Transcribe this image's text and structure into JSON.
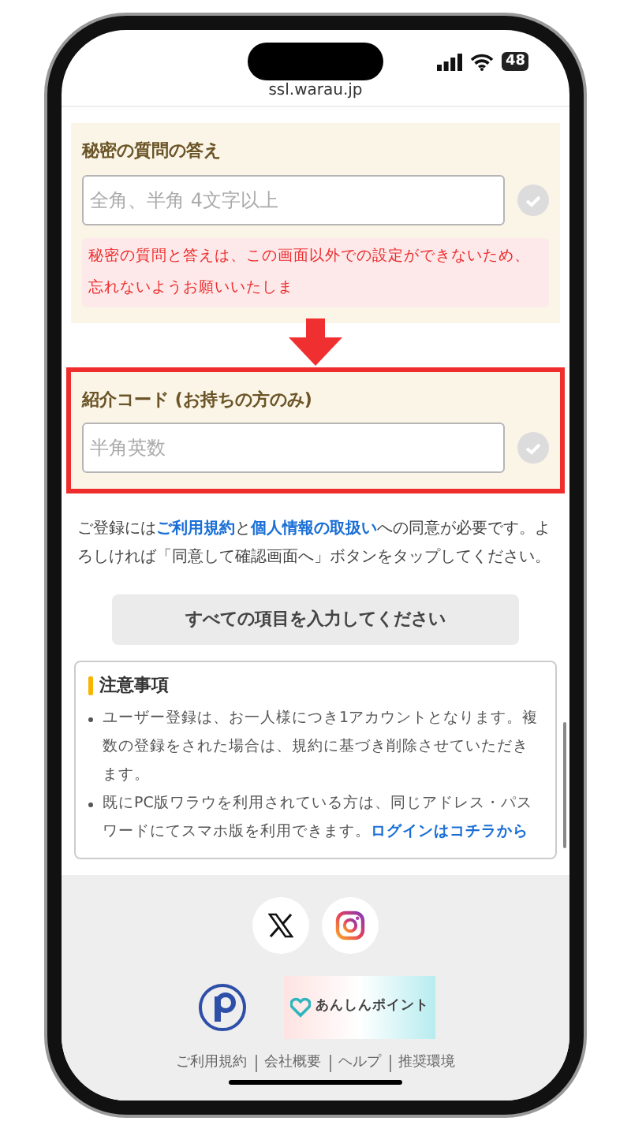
{
  "status_bar": {
    "battery": "48"
  },
  "address_bar": {
    "url": "ssl.warau.jp"
  },
  "form_fields": [
    {
      "label": "秘密の質問の答え",
      "placeholder": "全角、半角 4文字以上",
      "highlighted": false,
      "notice": "秘密の質問と答えは、この画面以外での設定ができないため、忘れないようお願いいたしま"
    },
    {
      "label": "紹介コード (お持ちの方のみ)",
      "placeholder": "半角英数",
      "highlighted": true
    }
  ],
  "consent": [
    {
      "text": "ご登録には",
      "link": false
    },
    {
      "text": "ご利用規約",
      "link": true
    },
    {
      "text": "と",
      "link": false
    },
    {
      "text": "個人情報の取扱い",
      "link": true
    },
    {
      "text": "への同意が必要です。よろしければ「同意して確認画面へ」ボタンをタップしてください。",
      "link": false
    }
  ],
  "submit_button": {
    "label": "すべての項目を入力してください",
    "disabled": true
  },
  "notes": {
    "title": "注意事項",
    "items": [
      [
        {
          "text": "ユーザー登録は、お一人様につき1アカウントとなります。複数の登録をされた場合は、規約に基づき削除させていただきます。",
          "link": false
        }
      ],
      [
        {
          "text": "既にPC版ワラウを利用されている方は、同じアドレス・パスワードにてスマホ版を利用できます。",
          "link": false
        },
        {
          "text": "ログインはコチラから",
          "link": true
        }
      ]
    ]
  },
  "footer": {
    "social": [
      {
        "kind": "x"
      },
      {
        "kind": "instagram"
      }
    ],
    "badge": "あんしんポイント",
    "links": [
      "ご利用規約",
      "会社概要",
      "ヘルプ",
      "推奨環境"
    ]
  }
}
